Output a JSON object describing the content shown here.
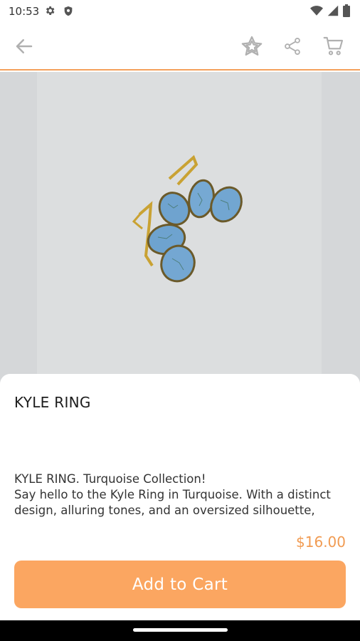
{
  "status_bar": {
    "time": "10:53",
    "icons": [
      "gear-icon",
      "shield-icon",
      "wifi-icon",
      "signal-icon",
      "battery-icon"
    ]
  },
  "app_bar": {
    "icons": [
      "back-arrow-icon",
      "star-icon",
      "share-icon",
      "cart-icon"
    ],
    "accent_color": "#f5a15c"
  },
  "product": {
    "title": "KYLE RING",
    "description_lines": [
      "KYLE RING. Turquoise Collection!",
      "Say hello to the Kyle Ring in Turquoise. With a distinct",
      "design, alluring tones, and an oversized silhouette,"
    ],
    "price": "$16.00"
  },
  "actions": {
    "add_to_cart_label": "Add to Cart",
    "button_color": "#fba661"
  }
}
